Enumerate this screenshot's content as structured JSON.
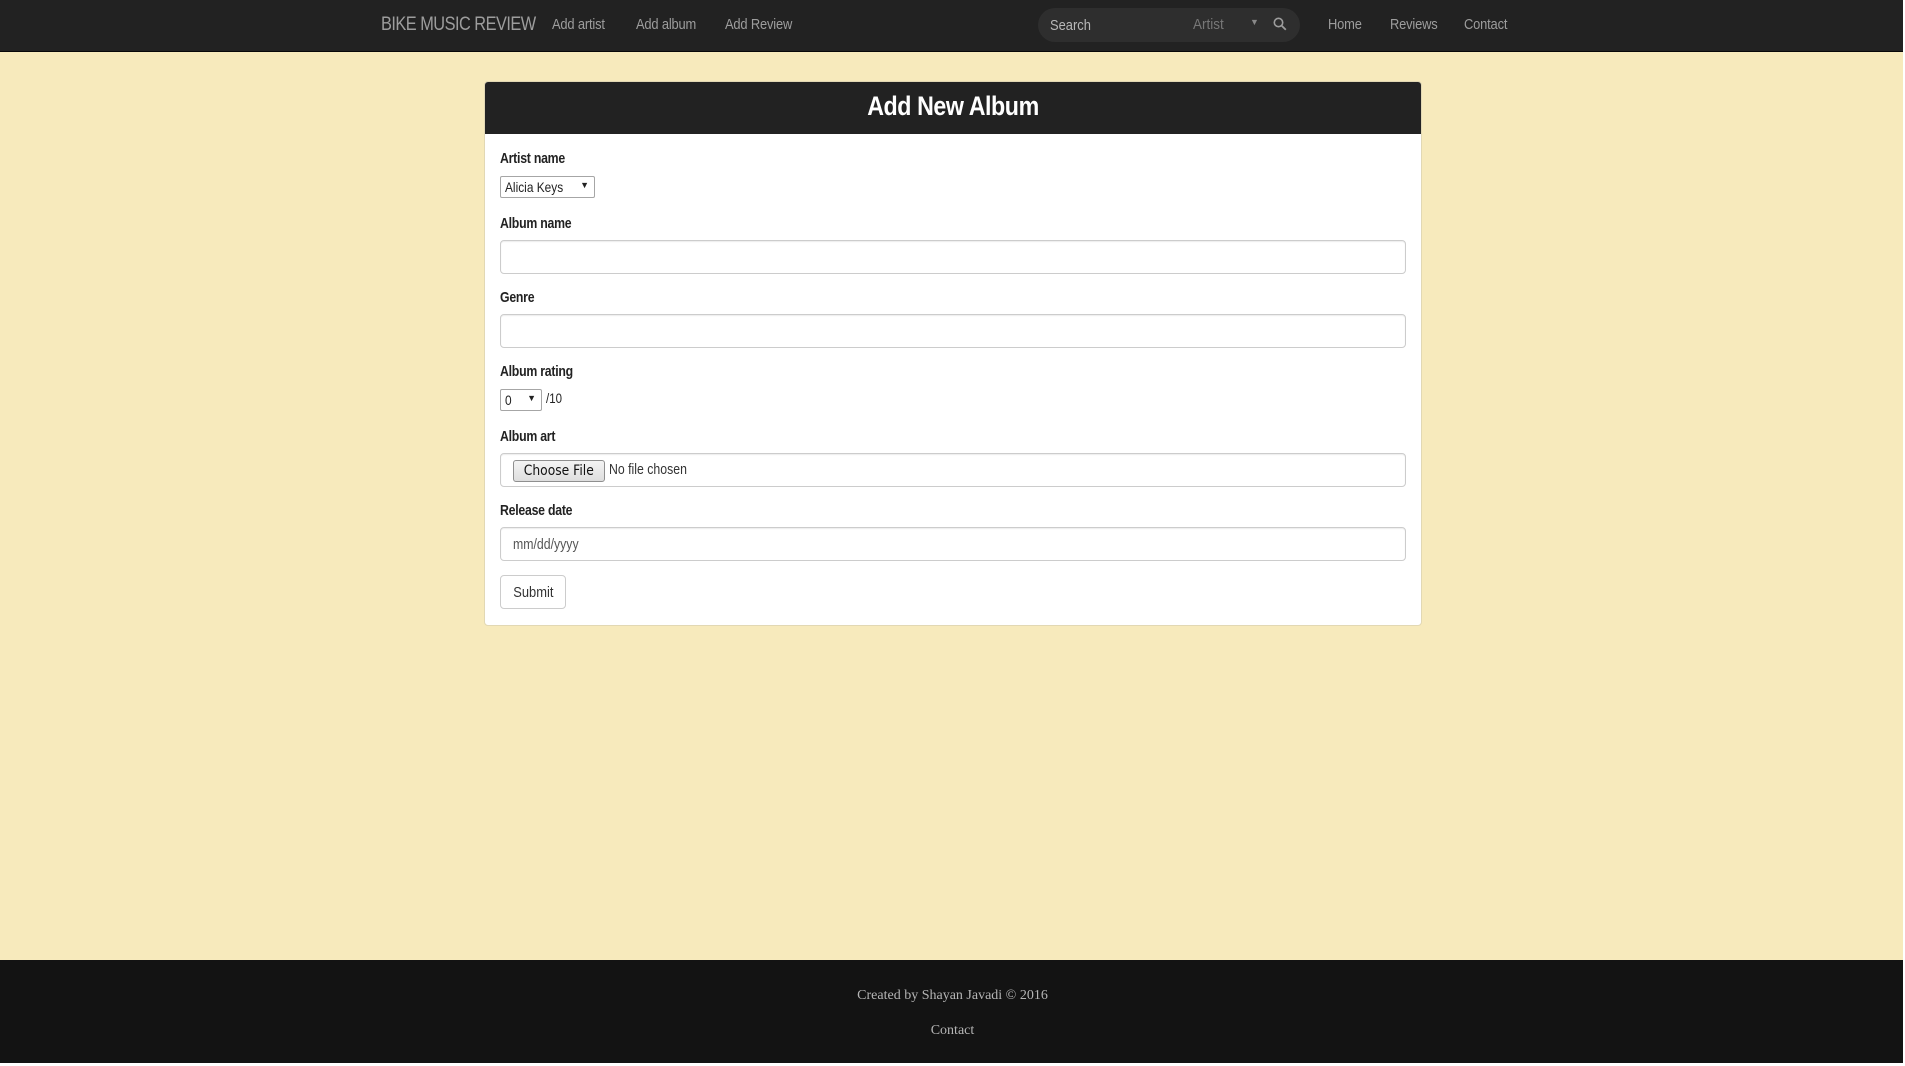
{
  "navbar": {
    "brand": "BIKE MUSIC REVIEW",
    "links": [
      "Add artist",
      "Add album",
      "Add Review"
    ],
    "search_placeholder": "Search",
    "search_type": "Artist",
    "right_links": [
      "Home",
      "Reviews",
      "Contact"
    ]
  },
  "panel": {
    "title": "Add New Album"
  },
  "form": {
    "artist_label": "Artist name",
    "artist_value": "Alicia Keys",
    "album_label": "Album name",
    "album_value": "",
    "genre_label": "Genre",
    "genre_value": "",
    "rating_label": "Album rating",
    "rating_value": "0",
    "rating_suffix": "/10",
    "art_label": "Album art",
    "art_button": "Choose File",
    "art_status": "No file chosen",
    "date_label": "Release date",
    "date_placeholder": "mm/dd/yyyy",
    "submit": "Submit"
  },
  "footer": {
    "credit": "Created by Shayan Javadi © 2016",
    "contact": "Contact"
  },
  "colors": {
    "background": "#f7eabc",
    "navbar": "#222222",
    "footer": "#131313"
  }
}
